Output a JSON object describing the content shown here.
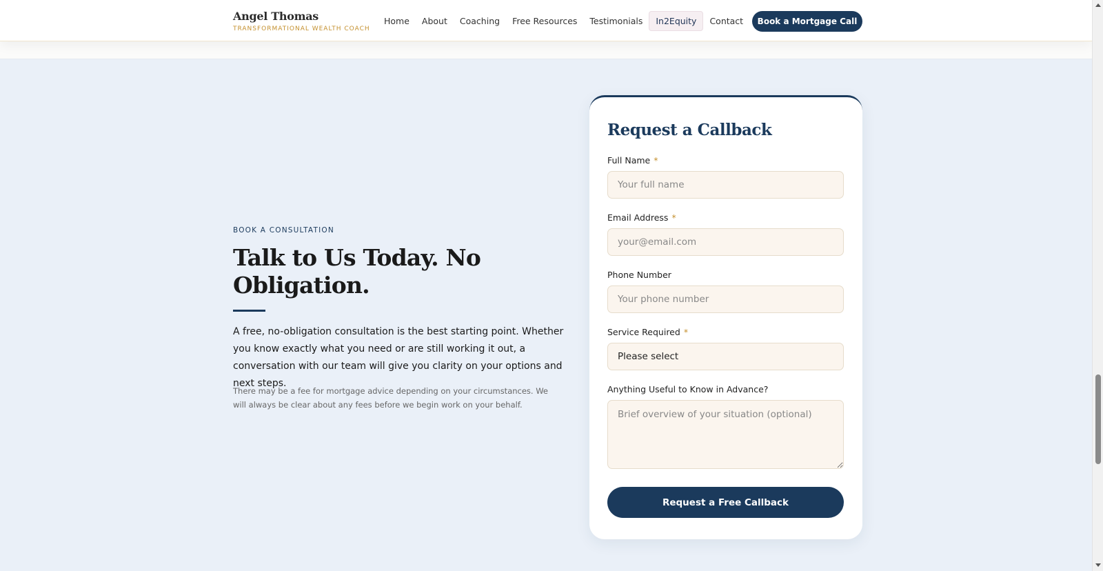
{
  "brand": {
    "name": "Angel Thomas",
    "tagline": "TRANSFORMATIONAL WEALTH COACH"
  },
  "nav": {
    "items": [
      {
        "label": "Home"
      },
      {
        "label": "About"
      },
      {
        "label": "Coaching"
      },
      {
        "label": "Free Resources"
      },
      {
        "label": "Testimonials"
      },
      {
        "label": "In2Equity"
      },
      {
        "label": "Contact"
      }
    ],
    "active": "In2Equity",
    "cta": "Book a Mortgage Call"
  },
  "intro": {
    "eyebrow": "BOOK A CONSULTATION",
    "headline": "Talk to Us Today. No Obligation.",
    "lead": "A free, no-obligation consultation is the best starting point. Whether you know exactly what you need or are still working it out, a conversation with our team will give you clarity on your options and next steps.",
    "note": "There may be a fee for mortgage advice depending on your circumstances. We will always be clear about any fees before we begin work on your behalf."
  },
  "form": {
    "title": "Request a Callback",
    "required_mark": "*",
    "full_name": {
      "label": "Full Name",
      "placeholder": "Your full name",
      "value": ""
    },
    "email": {
      "label": "Email Address",
      "placeholder": "your@email.com",
      "value": ""
    },
    "phone": {
      "label": "Phone Number",
      "placeholder": "Your phone number",
      "value": ""
    },
    "service": {
      "label": "Service Required",
      "selected": "Please select"
    },
    "notes": {
      "label": "Anything Useful to Know in Advance?",
      "placeholder": "Brief overview of your situation (optional)",
      "value": ""
    },
    "submit": "Request a Free Callback"
  },
  "colors": {
    "navy": "#1b3a5c",
    "gold": "#c4902e",
    "section_bg": "#eaf0f8",
    "field_bg": "#fbf5ee"
  }
}
